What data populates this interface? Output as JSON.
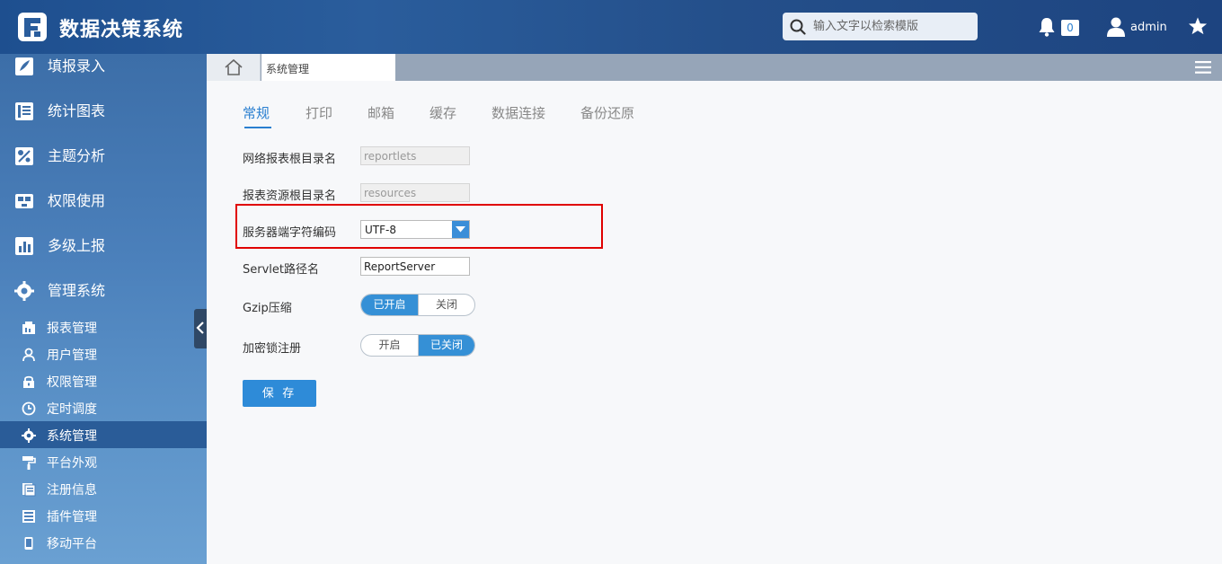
{
  "header": {
    "title": "数据决策系统",
    "search_placeholder": "输入文字以检索模版",
    "notification_count": "0",
    "username": "admin"
  },
  "sidebar": {
    "main_items": [
      {
        "label": "填报录入",
        "icon": "pen-icon"
      },
      {
        "label": "统计图表",
        "icon": "book-icon"
      },
      {
        "label": "主题分析",
        "icon": "analysis-icon"
      },
      {
        "label": "权限使用",
        "icon": "permission-icon"
      },
      {
        "label": "多级上报",
        "icon": "bar-chart-icon"
      },
      {
        "label": "管理系统",
        "icon": "gear-icon"
      }
    ],
    "sub_items": [
      {
        "label": "报表管理",
        "icon": "report-icon"
      },
      {
        "label": "用户管理",
        "icon": "user-icon"
      },
      {
        "label": "权限管理",
        "icon": "lock-icon"
      },
      {
        "label": "定时调度",
        "icon": "clock-icon"
      },
      {
        "label": "系统管理",
        "icon": "gear-icon",
        "active": true
      },
      {
        "label": "平台外观",
        "icon": "paint-roller-icon"
      },
      {
        "label": "注册信息",
        "icon": "register-icon"
      },
      {
        "label": "插件管理",
        "icon": "plugin-icon"
      },
      {
        "label": "移动平台",
        "icon": "mobile-icon"
      }
    ]
  },
  "tabbar": {
    "active_tab": "系统管理"
  },
  "settings": {
    "tabs": [
      "常规",
      "打印",
      "邮箱",
      "缓存",
      "数据连接",
      "备份还原"
    ],
    "active_tab": "常规",
    "fields": {
      "root_dir_label": "网络报表根目录名",
      "root_dir_value": "reportlets",
      "resource_dir_label": "报表资源根目录名",
      "resource_dir_value": "resources",
      "encoding_label": "服务器端字符编码",
      "encoding_value": "UTF-8",
      "servlet_label": "Servlet路径名",
      "servlet_value": "ReportServer",
      "gzip_label": "Gzip压缩",
      "gzip_on": "已开启",
      "gzip_off": "关闭",
      "gzip_state": "on",
      "lock_label": "加密锁注册",
      "lock_on": "开启",
      "lock_off": "已关闭",
      "lock_state": "off"
    },
    "save_label": "保 存"
  },
  "colors": {
    "accent": "#2a7fd0",
    "header_bg": "#244f8a",
    "highlight": "#e00000"
  }
}
